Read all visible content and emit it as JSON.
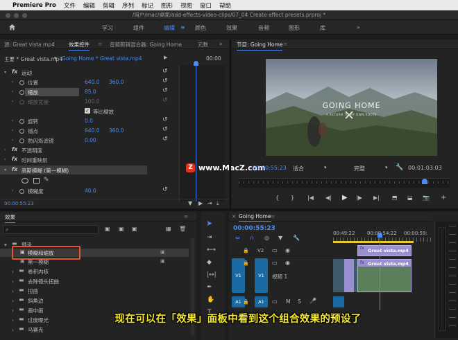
{
  "menubar": {
    "app": "Premiere Pro",
    "items": [
      "文件",
      "编辑",
      "剪辑",
      "序列",
      "标记",
      "图形",
      "视图",
      "窗口",
      "帮助"
    ]
  },
  "titlebar": {
    "path": "/用户/mac/桌面/add-effects-video-clips/07_04 Create effect presets.prproj *"
  },
  "workspace": {
    "tabs": [
      "学习",
      "组件",
      "编辑",
      "颜色",
      "效果",
      "音频",
      "图形",
      "库"
    ],
    "active": "编辑"
  },
  "source_panel": {
    "tabs": [
      "源: Great vista.mp4",
      "效果控件",
      "音频剪辑混合器: Going Home",
      "元数"
    ],
    "header": {
      "master": "主要 * Great vista.mp4",
      "seq": "Going Home * Great vista.mp4",
      "time": "00:00"
    },
    "rows": [
      {
        "type": "fx",
        "label": "运动"
      },
      {
        "label": "位置",
        "v1": "640.0",
        "v2": "360.0"
      },
      {
        "label": "缩放",
        "v1": "85.0"
      },
      {
        "label": "缩放宽度",
        "v1": "100.0",
        "disabled": true
      },
      {
        "label": "等比缩放",
        "checkbox": true
      },
      {
        "label": "旋转",
        "v1": "0.0"
      },
      {
        "label": "锚点",
        "v1": "640.0",
        "v2": "360.0"
      },
      {
        "label": "防闪烁滤镜",
        "v1": "0.00"
      },
      {
        "type": "fx",
        "label": "不透明度"
      },
      {
        "type": "fx",
        "label": "时间重映射"
      },
      {
        "type": "fx",
        "label": "高斯模糊 (第一模糊)"
      },
      {
        "label": "模糊度",
        "v1": "40.0"
      }
    ],
    "timecode": "00:00:55:23"
  },
  "program": {
    "title": "节目: Going Home",
    "video_title": "GOING HOME",
    "video_sub": "A RETURN TO MY OWN ROOTS",
    "timecode": "00:00:55:23",
    "fit": "适合",
    "quality": "完整",
    "duration": "00:01:03:03"
  },
  "watermark": "www.MacZ.com",
  "effects_panel": {
    "title": "效果",
    "tree": [
      {
        "label": "预设",
        "level": 0,
        "open": true
      },
      {
        "label": "模糊和缩放",
        "level": 1,
        "selected": true
      },
      {
        "label": "第一模糊",
        "level": 1
      },
      {
        "label": "卷积内核",
        "level": 1
      },
      {
        "label": "去除镜头扭曲",
        "level": 1
      },
      {
        "label": "扭曲",
        "level": 1
      },
      {
        "label": "斜角边",
        "level": 1
      },
      {
        "label": "画中画",
        "level": 1
      },
      {
        "label": "过度曝光",
        "level": 1
      },
      {
        "label": "马赛克",
        "level": 1
      }
    ]
  },
  "timeline": {
    "title": "Going Home",
    "timecode": "00:00:55:23",
    "ruler": [
      "00:49:22",
      "00:00:54:22",
      "00:00:59:"
    ],
    "tracks": [
      {
        "name": "V2",
        "src": ""
      },
      {
        "name": "V1",
        "src": "V1",
        "label": "视频 1"
      },
      {
        "name": "A1",
        "src": "A1",
        "controls": [
          "M",
          "S"
        ]
      }
    ],
    "clips": [
      "Great vista.mp4",
      "Great vista.mp4"
    ]
  },
  "subtitle": "现在可以在「效果」面板中看到这个组合效果的预设了",
  "colors": {
    "accent": "#4b8cf5",
    "highlight": "#e8542c",
    "clip": "#9a8fd0",
    "subtitle": "#f7e92e"
  }
}
